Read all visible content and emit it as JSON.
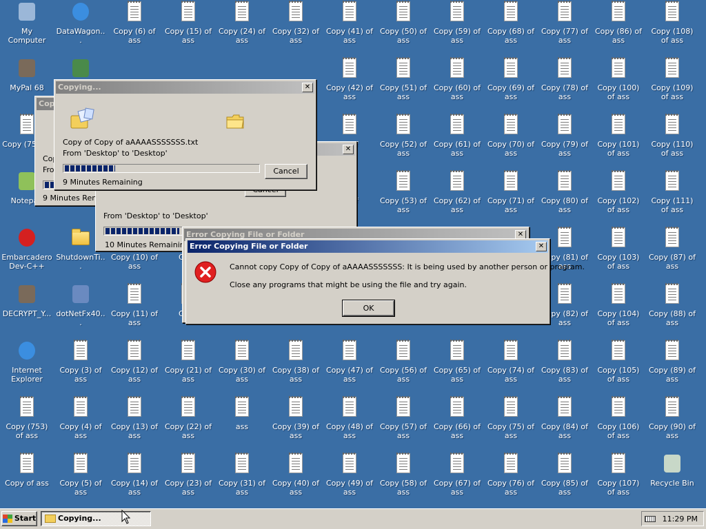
{
  "desktop_icons": [
    {
      "label": "My Computer",
      "icon": "computer-icon",
      "col": 0,
      "row": 0
    },
    {
      "label": "DataWagon...",
      "icon": "internet-explorer-icon",
      "col": 1,
      "row": 0
    },
    {
      "label": "Copy (6) of ass",
      "icon": "text-file-icon",
      "col": 2,
      "row": 0
    },
    {
      "label": "Copy (15) of ass",
      "icon": "text-file-icon",
      "col": 3,
      "row": 0
    },
    {
      "label": "Copy (24) of ass",
      "icon": "text-file-icon",
      "col": 4,
      "row": 0
    },
    {
      "label": "Copy (32) of ass",
      "icon": "text-file-icon",
      "col": 5,
      "row": 0
    },
    {
      "label": "Copy (41) of ass",
      "icon": "text-file-icon",
      "col": 6,
      "row": 0
    },
    {
      "label": "Copy (50) of ass",
      "icon": "text-file-icon",
      "col": 7,
      "row": 0
    },
    {
      "label": "Copy (59) of ass",
      "icon": "text-file-icon",
      "col": 8,
      "row": 0
    },
    {
      "label": "Copy (68) of ass",
      "icon": "text-file-icon",
      "col": 9,
      "row": 0
    },
    {
      "label": "Copy (77) of ass",
      "icon": "text-file-icon",
      "col": 10,
      "row": 0
    },
    {
      "label": "Copy (86) of ass",
      "icon": "text-file-icon",
      "col": 11,
      "row": 0
    },
    {
      "label": "Copy (108) of ass",
      "icon": "text-file-icon",
      "col": 12,
      "row": 0
    },
    {
      "label": "MyPal 68",
      "icon": "raccoon-icon",
      "col": 0,
      "row": 1
    },
    {
      "label": "",
      "icon": "monitor-icon",
      "col": 1,
      "row": 1
    },
    {
      "label": "Copy (42) of ass",
      "icon": "text-file-icon",
      "col": 6,
      "row": 1
    },
    {
      "label": "Copy (51) of ass",
      "icon": "text-file-icon",
      "col": 7,
      "row": 1
    },
    {
      "label": "Copy (60) of ass",
      "icon": "text-file-icon",
      "col": 8,
      "row": 1
    },
    {
      "label": "Copy (69) of ass",
      "icon": "text-file-icon",
      "col": 9,
      "row": 1
    },
    {
      "label": "Copy (78) of ass",
      "icon": "text-file-icon",
      "col": 10,
      "row": 1
    },
    {
      "label": "Copy (100) of ass",
      "icon": "text-file-icon",
      "col": 11,
      "row": 1
    },
    {
      "label": "Copy (109) of ass",
      "icon": "text-file-icon",
      "col": 12,
      "row": 1
    },
    {
      "label": "Copy (75 ass",
      "icon": "text-file-icon",
      "col": 0,
      "row": 2
    },
    {
      "label": "8) of",
      "icon": "text-file-icon",
      "col": 6,
      "row": 2
    },
    {
      "label": "Copy (52) of ass",
      "icon": "text-file-icon",
      "col": 7,
      "row": 2
    },
    {
      "label": "Copy (61) of ass",
      "icon": "text-file-icon",
      "col": 8,
      "row": 2
    },
    {
      "label": "Copy (70) of ass",
      "icon": "text-file-icon",
      "col": 9,
      "row": 2
    },
    {
      "label": "Copy (79) of ass",
      "icon": "text-file-icon",
      "col": 10,
      "row": 2
    },
    {
      "label": "Copy (101) of ass",
      "icon": "text-file-icon",
      "col": 11,
      "row": 2
    },
    {
      "label": "Copy (110) of ass",
      "icon": "text-file-icon",
      "col": 12,
      "row": 2
    },
    {
      "label": "Notepad",
      "icon": "notepad-plus-icon",
      "col": 0,
      "row": 3
    },
    {
      "label": "4) of",
      "icon": "text-file-icon",
      "col": 6,
      "row": 3
    },
    {
      "label": "Copy (53) of ass",
      "icon": "text-file-icon",
      "col": 7,
      "row": 3
    },
    {
      "label": "Copy (62) of ass",
      "icon": "text-file-icon",
      "col": 8,
      "row": 3
    },
    {
      "label": "Copy (71) of ass",
      "icon": "text-file-icon",
      "col": 9,
      "row": 3
    },
    {
      "label": "Copy (80) of ass",
      "icon": "text-file-icon",
      "col": 10,
      "row": 3
    },
    {
      "label": "Copy (102) of ass",
      "icon": "text-file-icon",
      "col": 11,
      "row": 3
    },
    {
      "label": "Copy (111) of ass",
      "icon": "text-file-icon",
      "col": 12,
      "row": 3
    },
    {
      "label": "Embarcadero Dev-C++",
      "icon": "devcpp-icon",
      "col": 0,
      "row": 4
    },
    {
      "label": "ShutdownTi...",
      "icon": "folder-icon",
      "col": 1,
      "row": 4
    },
    {
      "label": "Copy (10) of ass",
      "icon": "text-file-icon",
      "col": 2,
      "row": 4
    },
    {
      "label": "Copy",
      "icon": "text-file-icon",
      "col": 3,
      "row": 4
    },
    {
      "label": "Copy (81) of ass",
      "icon": "text-file-icon",
      "col": 10,
      "row": 4
    },
    {
      "label": "Copy (103) of ass",
      "icon": "text-file-icon",
      "col": 11,
      "row": 4
    },
    {
      "label": "Copy (87) of ass",
      "icon": "text-file-icon",
      "col": 12,
      "row": 4
    },
    {
      "label": "DECRYPT_Y...",
      "icon": "raccoon-icon",
      "col": 0,
      "row": 5
    },
    {
      "label": "dotNetFx40...",
      "icon": "installer-icon",
      "col": 1,
      "row": 5
    },
    {
      "label": "Copy (11) of ass",
      "icon": "text-file-icon",
      "col": 2,
      "row": 5
    },
    {
      "label": "Copy",
      "icon": "text-file-icon",
      "col": 3,
      "row": 5
    },
    {
      "label": "Copy (82) of ass",
      "icon": "text-file-icon",
      "col": 10,
      "row": 5
    },
    {
      "label": "Copy (104) of ass",
      "icon": "text-file-icon",
      "col": 11,
      "row": 5
    },
    {
      "label": "Copy (88) of ass",
      "icon": "text-file-icon",
      "col": 12,
      "row": 5
    },
    {
      "label": "Internet Explorer",
      "icon": "internet-explorer-icon",
      "col": 0,
      "row": 6
    },
    {
      "label": "Copy (3) of ass",
      "icon": "text-file-icon",
      "col": 1,
      "row": 6
    },
    {
      "label": "Copy (12) of ass",
      "icon": "text-file-icon",
      "col": 2,
      "row": 6
    },
    {
      "label": "Copy (21) of ass",
      "icon": "text-file-icon",
      "col": 3,
      "row": 6
    },
    {
      "label": "Copy (30) of ass",
      "icon": "text-file-icon",
      "col": 4,
      "row": 6
    },
    {
      "label": "Copy (38) of ass",
      "icon": "text-file-icon",
      "col": 5,
      "row": 6
    },
    {
      "label": "Copy (47) of ass",
      "icon": "text-file-icon",
      "col": 6,
      "row": 6
    },
    {
      "label": "Copy (56) of ass",
      "icon": "text-file-icon",
      "col": 7,
      "row": 6
    },
    {
      "label": "Copy (65) of ass",
      "icon": "text-file-icon",
      "col": 8,
      "row": 6
    },
    {
      "label": "Copy (74) of ass",
      "icon": "text-file-icon",
      "col": 9,
      "row": 6
    },
    {
      "label": "Copy (83) of ass",
      "icon": "text-file-icon",
      "col": 10,
      "row": 6
    },
    {
      "label": "Copy (105) of ass",
      "icon": "text-file-icon",
      "col": 11,
      "row": 6
    },
    {
      "label": "Copy (89) of ass",
      "icon": "text-file-icon",
      "col": 12,
      "row": 6
    },
    {
      "label": "Copy (753) of ass",
      "icon": "text-file-icon",
      "col": 0,
      "row": 7
    },
    {
      "label": "Copy (4) of ass",
      "icon": "text-file-icon",
      "col": 1,
      "row": 7
    },
    {
      "label": "Copy (13) of ass",
      "icon": "text-file-icon",
      "col": 2,
      "row": 7
    },
    {
      "label": "Copy (22) of ass",
      "icon": "text-file-icon",
      "col": 3,
      "row": 7
    },
    {
      "label": "ass",
      "icon": "text-file-icon",
      "col": 4,
      "row": 7
    },
    {
      "label": "Copy (39) of ass",
      "icon": "text-file-icon",
      "col": 5,
      "row": 7
    },
    {
      "label": "Copy (48) of ass",
      "icon": "text-file-icon",
      "col": 6,
      "row": 7
    },
    {
      "label": "Copy (57) of ass",
      "icon": "text-file-icon",
      "col": 7,
      "row": 7
    },
    {
      "label": "Copy (66) of ass",
      "icon": "text-file-icon",
      "col": 8,
      "row": 7
    },
    {
      "label": "Copy (75) of ass",
      "icon": "text-file-icon",
      "col": 9,
      "row": 7
    },
    {
      "label": "Copy (84) of ass",
      "icon": "text-file-icon",
      "col": 10,
      "row": 7
    },
    {
      "label": "Copy (106) of ass",
      "icon": "text-file-icon",
      "col": 11,
      "row": 7
    },
    {
      "label": "Copy (90) of ass",
      "icon": "text-file-icon",
      "col": 12,
      "row": 7
    },
    {
      "label": "Copy of ass",
      "icon": "text-file-icon",
      "col": 0,
      "row": 8
    },
    {
      "label": "Copy (5) of ass",
      "icon": "text-file-icon",
      "col": 1,
      "row": 8
    },
    {
      "label": "Copy (14) of ass",
      "icon": "text-file-icon",
      "col": 2,
      "row": 8
    },
    {
      "label": "Copy (23) of ass",
      "icon": "text-file-icon",
      "col": 3,
      "row": 8
    },
    {
      "label": "Copy (31) of ass",
      "icon": "text-file-icon",
      "col": 4,
      "row": 8
    },
    {
      "label": "Copy (40) of ass",
      "icon": "text-file-icon",
      "col": 5,
      "row": 8
    },
    {
      "label": "Copy (49) of ass",
      "icon": "text-file-icon",
      "col": 6,
      "row": 8
    },
    {
      "label": "Copy (58) of ass",
      "icon": "text-file-icon",
      "col": 7,
      "row": 8
    },
    {
      "label": "Copy (67) of ass",
      "icon": "text-file-icon",
      "col": 8,
      "row": 8
    },
    {
      "label": "Copy (76) of ass",
      "icon": "text-file-icon",
      "col": 9,
      "row": 8
    },
    {
      "label": "Copy (85) of ass",
      "icon": "text-file-icon",
      "col": 10,
      "row": 8
    },
    {
      "label": "Copy (107) of ass",
      "icon": "text-file-icon",
      "col": 11,
      "row": 8
    },
    {
      "label": "Recycle Bin",
      "icon": "recycle-bin-icon",
      "col": 12,
      "row": 8
    }
  ],
  "copy_dialog_back": {
    "title": "Copy...",
    "file_text": "Cop",
    "from_text": "Fro",
    "remaining": "9 Minutes Remaining",
    "progress": 0.1
  },
  "copy_dialog_mid": {
    "from_text": "From 'Desktop' to 'Desktop'",
    "remaining": "10 Minutes Remaining",
    "progress": 0.32,
    "cancel_label": "Cancel"
  },
  "copy_dialog_front": {
    "title": "Copying...",
    "file_name": "Copy of Copy of aAAAASSSSSSS.txt",
    "from_text": "From 'Desktop' to 'Desktop'",
    "remaining": "9 Minutes Remaining",
    "progress": 0.26,
    "cancel_label": "Cancel"
  },
  "error_dialog_back": {
    "title": "Error Copying File or Folder"
  },
  "error_dialog": {
    "title": "Error Copying File or Folder",
    "message": "Cannot copy Copy of Copy of aAAAASSSSSSS: It is being used by another person or program.",
    "hint": "Close any programs that might be using the file and try again.",
    "ok_label": "OK"
  },
  "taskbar": {
    "start_label": "Start",
    "task_label": "Copying...",
    "clock": "11:29 PM"
  },
  "colors": {
    "desktop": "#3a6ea5",
    "titlebar_active": "#0a246a",
    "titlebar_inactive": "#808080",
    "face": "#d4d0c8"
  }
}
